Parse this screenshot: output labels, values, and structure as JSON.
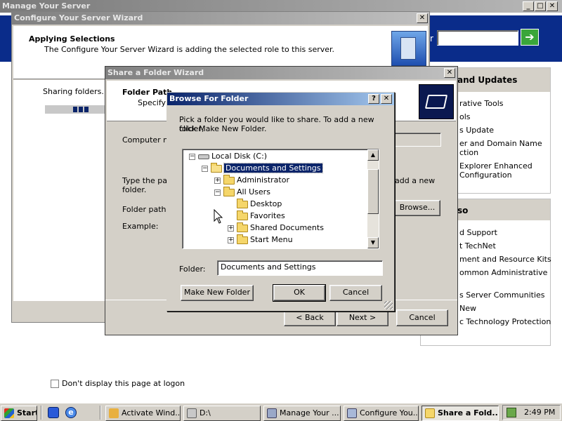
{
  "manage_server": {
    "title": "Manage Your Server",
    "go_arrow": "➔",
    "search_value": "",
    "tools_header": "and Updates",
    "tools_items": [
      "rative Tools",
      "ols",
      "s Update",
      "er and Domain Name",
      "ction",
      "Explorer Enhanced",
      "Configuration"
    ],
    "see_also_header": "so",
    "see_also_items": [
      "d Support",
      "t TechNet",
      "ment and Resource Kits",
      "ommon Administrative",
      "s Server Communities",
      "New",
      "c Technology Protection"
    ],
    "dont_display_label": "Don't display this page at logon"
  },
  "configure_wizard": {
    "title": "Configure Your Server Wizard",
    "heading": "Applying Selections",
    "subheading": "The Configure Your Server Wizard is adding the selected role to this server.",
    "status": "Sharing folders...",
    "progress": 0.07
  },
  "share_wizard": {
    "title": "Share a Folder Wizard",
    "heading": "Folder Path",
    "subheading": "Specify t",
    "computer_name_label": "Computer nar",
    "instruction": "Type the path",
    "instruction_line2": "folder.",
    "instruction_right": "add a new",
    "folder_path_label": "Folder path:",
    "example_label": "Example:",
    "browse_label": "Browse...",
    "back_label": "< Back",
    "next_label": "Next >",
    "cancel_label": "Cancel"
  },
  "browse_folder": {
    "title": "Browse For Folder",
    "help_label": "?",
    "instructions_line1": "Pick a folder you would like to share. To add a new folder,",
    "instructions_line2": "click Make New Folder.",
    "tree": [
      {
        "label": "Local Disk (C:)",
        "expander": "−",
        "type": "drive"
      },
      {
        "label": "Documents and Settings",
        "expander": "−",
        "type": "folder",
        "selected": true
      },
      {
        "label": "Administrator",
        "expander": "+",
        "type": "folder"
      },
      {
        "label": "All Users",
        "expander": "−",
        "type": "folder"
      },
      {
        "label": "Desktop",
        "expander": "",
        "type": "folder"
      },
      {
        "label": "Favorites",
        "expander": "",
        "type": "folder"
      },
      {
        "label": "Shared Documents",
        "expander": "+",
        "type": "folder"
      },
      {
        "label": "Start Menu",
        "expander": "+",
        "type": "folder"
      }
    ],
    "folder_label": "Folder:",
    "folder_value": "Documents and Settings",
    "make_new_folder_label": "Make New Folder",
    "ok_label": "OK",
    "cancel_label": "Cancel"
  },
  "taskbar": {
    "start_label": "Start",
    "buttons": [
      "Activate Wind...",
      "D:\\",
      "Manage Your ...",
      "Configure You...",
      "Share a Fold..."
    ],
    "clock": "2:49 PM"
  }
}
